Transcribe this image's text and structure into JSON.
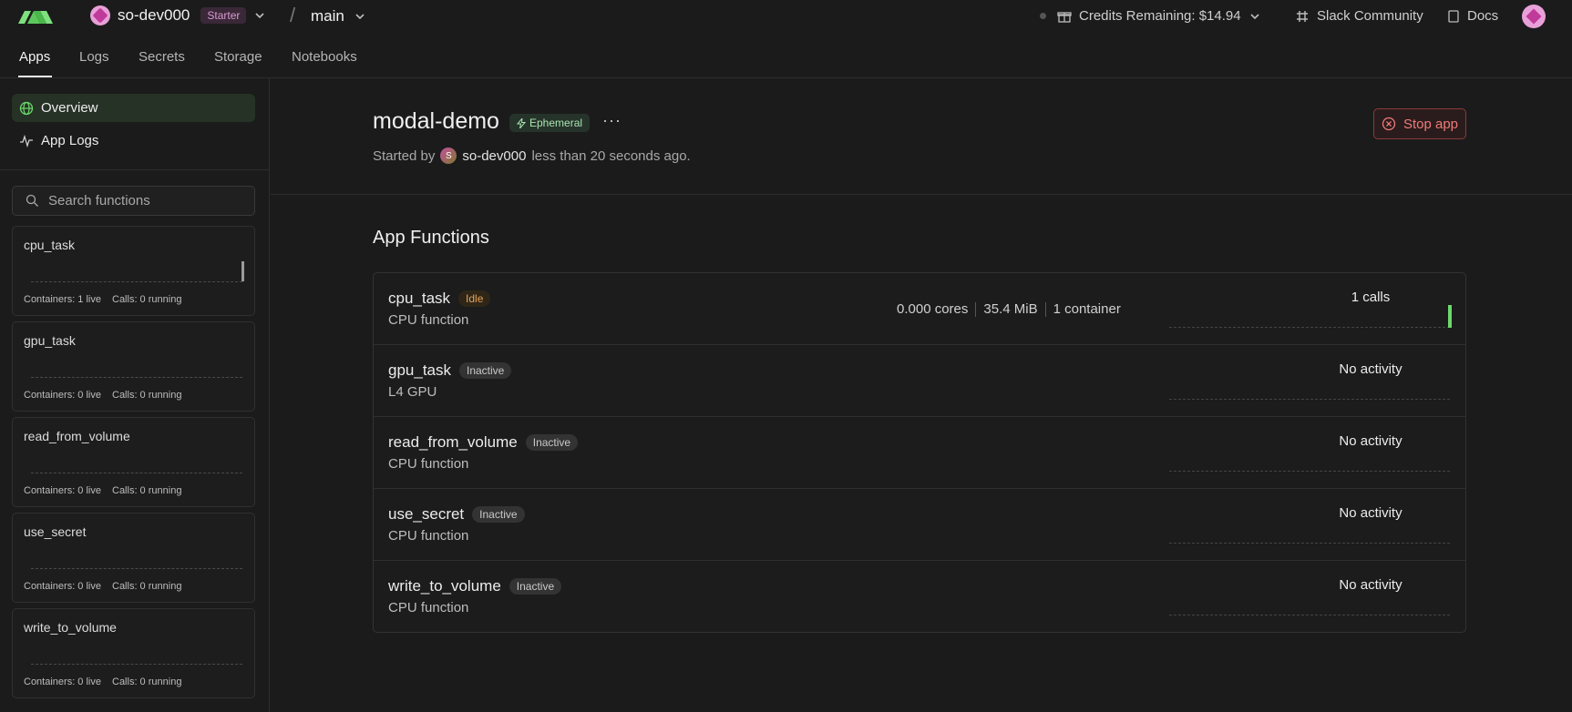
{
  "topbar": {
    "workspace": "so-dev000",
    "plan_badge": "Starter",
    "environment": "main",
    "credits": "Credits Remaining: $14.94",
    "slack": "Slack Community",
    "docs": "Docs"
  },
  "nav": {
    "tabs": [
      "Apps",
      "Logs",
      "Secrets",
      "Storage",
      "Notebooks"
    ],
    "active": "Apps"
  },
  "sidebar": {
    "items": [
      {
        "label": "Overview",
        "icon": "globe-icon"
      },
      {
        "label": "App Logs",
        "icon": "activity-icon"
      }
    ],
    "search_placeholder": "Search functions",
    "functions": [
      {
        "name": "cpu_task",
        "containers": "Containers: 1 live",
        "calls": "Calls: 0 running"
      },
      {
        "name": "gpu_task",
        "containers": "Containers: 0 live",
        "calls": "Calls: 0 running"
      },
      {
        "name": "read_from_volume",
        "containers": "Containers: 0 live",
        "calls": "Calls: 0 running"
      },
      {
        "name": "use_secret",
        "containers": "Containers: 0 live",
        "calls": "Calls: 0 running"
      },
      {
        "name": "write_to_volume",
        "containers": "Containers: 0 live",
        "calls": "Calls: 0 running"
      }
    ]
  },
  "app": {
    "title": "modal-demo",
    "badge": "Ephemeral",
    "started_prefix": "Started by",
    "avatar_letter": "S",
    "started_by": "so-dev000",
    "started_suffix": "less than 20 seconds ago.",
    "stop_label": "Stop app"
  },
  "functions_section": {
    "title": "App Functions",
    "rows": [
      {
        "name": "cpu_task",
        "status": "Idle",
        "type": "CPU function",
        "cores": "0.000 cores",
        "memory": "35.4 MiB",
        "containers": "1 container",
        "activity": "1 calls"
      },
      {
        "name": "gpu_task",
        "status": "Inactive",
        "type": "L4 GPU",
        "activity": "No activity"
      },
      {
        "name": "read_from_volume",
        "status": "Inactive",
        "type": "CPU function",
        "activity": "No activity"
      },
      {
        "name": "use_secret",
        "status": "Inactive",
        "type": "CPU function",
        "activity": "No activity"
      },
      {
        "name": "write_to_volume",
        "status": "Inactive",
        "type": "CPU function",
        "activity": "No activity"
      }
    ]
  },
  "colors": {
    "background": "#1b1b1b",
    "accent_green": "#6bd86b",
    "stop_red": "#f07a7a",
    "idle_orange": "#e5a15a"
  }
}
